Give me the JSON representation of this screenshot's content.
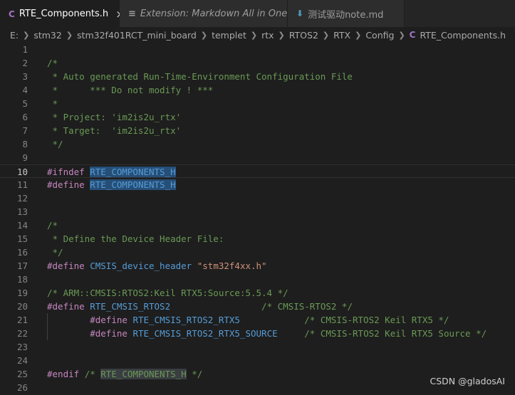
{
  "tabs": [
    {
      "label": "RTE_Components.h",
      "icon": "c-file-icon",
      "active": true,
      "close": "×"
    },
    {
      "label": "Extension: Markdown All in One",
      "icon": "extension-icon",
      "active": false
    },
    {
      "label": "测试驱动note.md",
      "icon": "download-icon",
      "active": false
    }
  ],
  "breadcrumb": [
    "E:",
    "stm32",
    "stm32f401RCT_mini_board",
    "templet",
    "rtx",
    "RTOS2",
    "RTX",
    "Config",
    "RTE_Components.h"
  ],
  "breadcrumb_file_icon": "C",
  "editor": {
    "current_line": 10,
    "lines": [
      {
        "n": "1",
        "tokens": []
      },
      {
        "n": "2",
        "tokens": [
          {
            "t": "/*",
            "c": "comment"
          }
        ]
      },
      {
        "n": "3",
        "tokens": [
          {
            "t": " * Auto generated Run-Time-Environment Configuration File",
            "c": "comment"
          }
        ]
      },
      {
        "n": "4",
        "tokens": [
          {
            "t": " *      *** Do not modify ! ***",
            "c": "comment"
          }
        ]
      },
      {
        "n": "5",
        "tokens": [
          {
            "t": " *",
            "c": "comment"
          }
        ]
      },
      {
        "n": "6",
        "tokens": [
          {
            "t": " * Project: 'im2is2u_rtx'",
            "c": "comment"
          }
        ]
      },
      {
        "n": "7",
        "tokens": [
          {
            "t": " * Target:  'im2is2u_rtx'",
            "c": "comment"
          }
        ]
      },
      {
        "n": "8",
        "tokens": [
          {
            "t": " */",
            "c": "comment"
          }
        ]
      },
      {
        "n": "9",
        "tokens": []
      },
      {
        "n": "10",
        "tokens": [
          {
            "t": "#ifndef",
            "c": "directive"
          },
          {
            "t": " ",
            "c": "plain"
          },
          {
            "t": "RTE_COMPONENTS_H",
            "c": "macro",
            "hl": true
          }
        ]
      },
      {
        "n": "11",
        "tokens": [
          {
            "t": "#define",
            "c": "directive"
          },
          {
            "t": " ",
            "c": "plain"
          },
          {
            "t": "RTE_COMPONENTS_H",
            "c": "macro",
            "hl": true
          }
        ]
      },
      {
        "n": "12",
        "tokens": []
      },
      {
        "n": "13",
        "tokens": []
      },
      {
        "n": "14",
        "tokens": [
          {
            "t": "/*",
            "c": "comment"
          }
        ]
      },
      {
        "n": "15",
        "tokens": [
          {
            "t": " * Define the Device Header File:",
            "c": "comment"
          }
        ]
      },
      {
        "n": "16",
        "tokens": [
          {
            "t": " */",
            "c": "comment"
          }
        ]
      },
      {
        "n": "17",
        "tokens": [
          {
            "t": "#define",
            "c": "directive"
          },
          {
            "t": " ",
            "c": "plain"
          },
          {
            "t": "CMSIS_device_header",
            "c": "macro"
          },
          {
            "t": " ",
            "c": "plain"
          },
          {
            "t": "\"stm32f4xx.h\"",
            "c": "string"
          }
        ]
      },
      {
        "n": "18",
        "tokens": []
      },
      {
        "n": "19",
        "tokens": [
          {
            "t": "/* ARM::CMSIS:RTOS2:Keil RTX5:Source:5.5.4 */",
            "c": "comment"
          }
        ]
      },
      {
        "n": "20",
        "tokens": [
          {
            "t": "#define",
            "c": "directive"
          },
          {
            "t": " ",
            "c": "plain"
          },
          {
            "t": "RTE_CMSIS_RTOS2",
            "c": "macro"
          },
          {
            "t": "                 ",
            "c": "plain"
          },
          {
            "t": "/* CMSIS-RTOS2 */",
            "c": "comment"
          }
        ]
      },
      {
        "n": "21",
        "tokens": [
          {
            "t": "        ",
            "c": "plain"
          },
          {
            "t": "#define",
            "c": "directive"
          },
          {
            "t": " ",
            "c": "plain"
          },
          {
            "t": "RTE_CMSIS_RTOS2_RTX5",
            "c": "macro"
          },
          {
            "t": "            ",
            "c": "plain"
          },
          {
            "t": "/* CMSIS-RTOS2 Keil RTX5 */",
            "c": "comment"
          }
        ]
      },
      {
        "n": "22",
        "tokens": [
          {
            "t": "        ",
            "c": "plain"
          },
          {
            "t": "#define",
            "c": "directive"
          },
          {
            "t": " ",
            "c": "plain"
          },
          {
            "t": "RTE_CMSIS_RTOS2_RTX5_SOURCE",
            "c": "macro"
          },
          {
            "t": "     ",
            "c": "plain"
          },
          {
            "t": "/* CMSIS-RTOS2 Keil RTX5 Source */",
            "c": "comment"
          }
        ]
      },
      {
        "n": "23",
        "tokens": []
      },
      {
        "n": "24",
        "tokens": []
      },
      {
        "n": "25",
        "tokens": [
          {
            "t": "#endif",
            "c": "directive"
          },
          {
            "t": " ",
            "c": "plain"
          },
          {
            "t": "/* ",
            "c": "comment"
          },
          {
            "t": "RTE_COMPONENTS_H",
            "c": "comment",
            "hlsoft": true
          },
          {
            "t": " */",
            "c": "comment"
          }
        ]
      },
      {
        "n": "26",
        "tokens": []
      }
    ]
  },
  "watermark": "CSDN @gladosAI",
  "colors": {
    "background": "#1e1e1e",
    "comment": "#6a9955",
    "directive": "#c586c0",
    "macro": "#569cd6",
    "string": "#ce9178",
    "selection": "#264f78"
  }
}
